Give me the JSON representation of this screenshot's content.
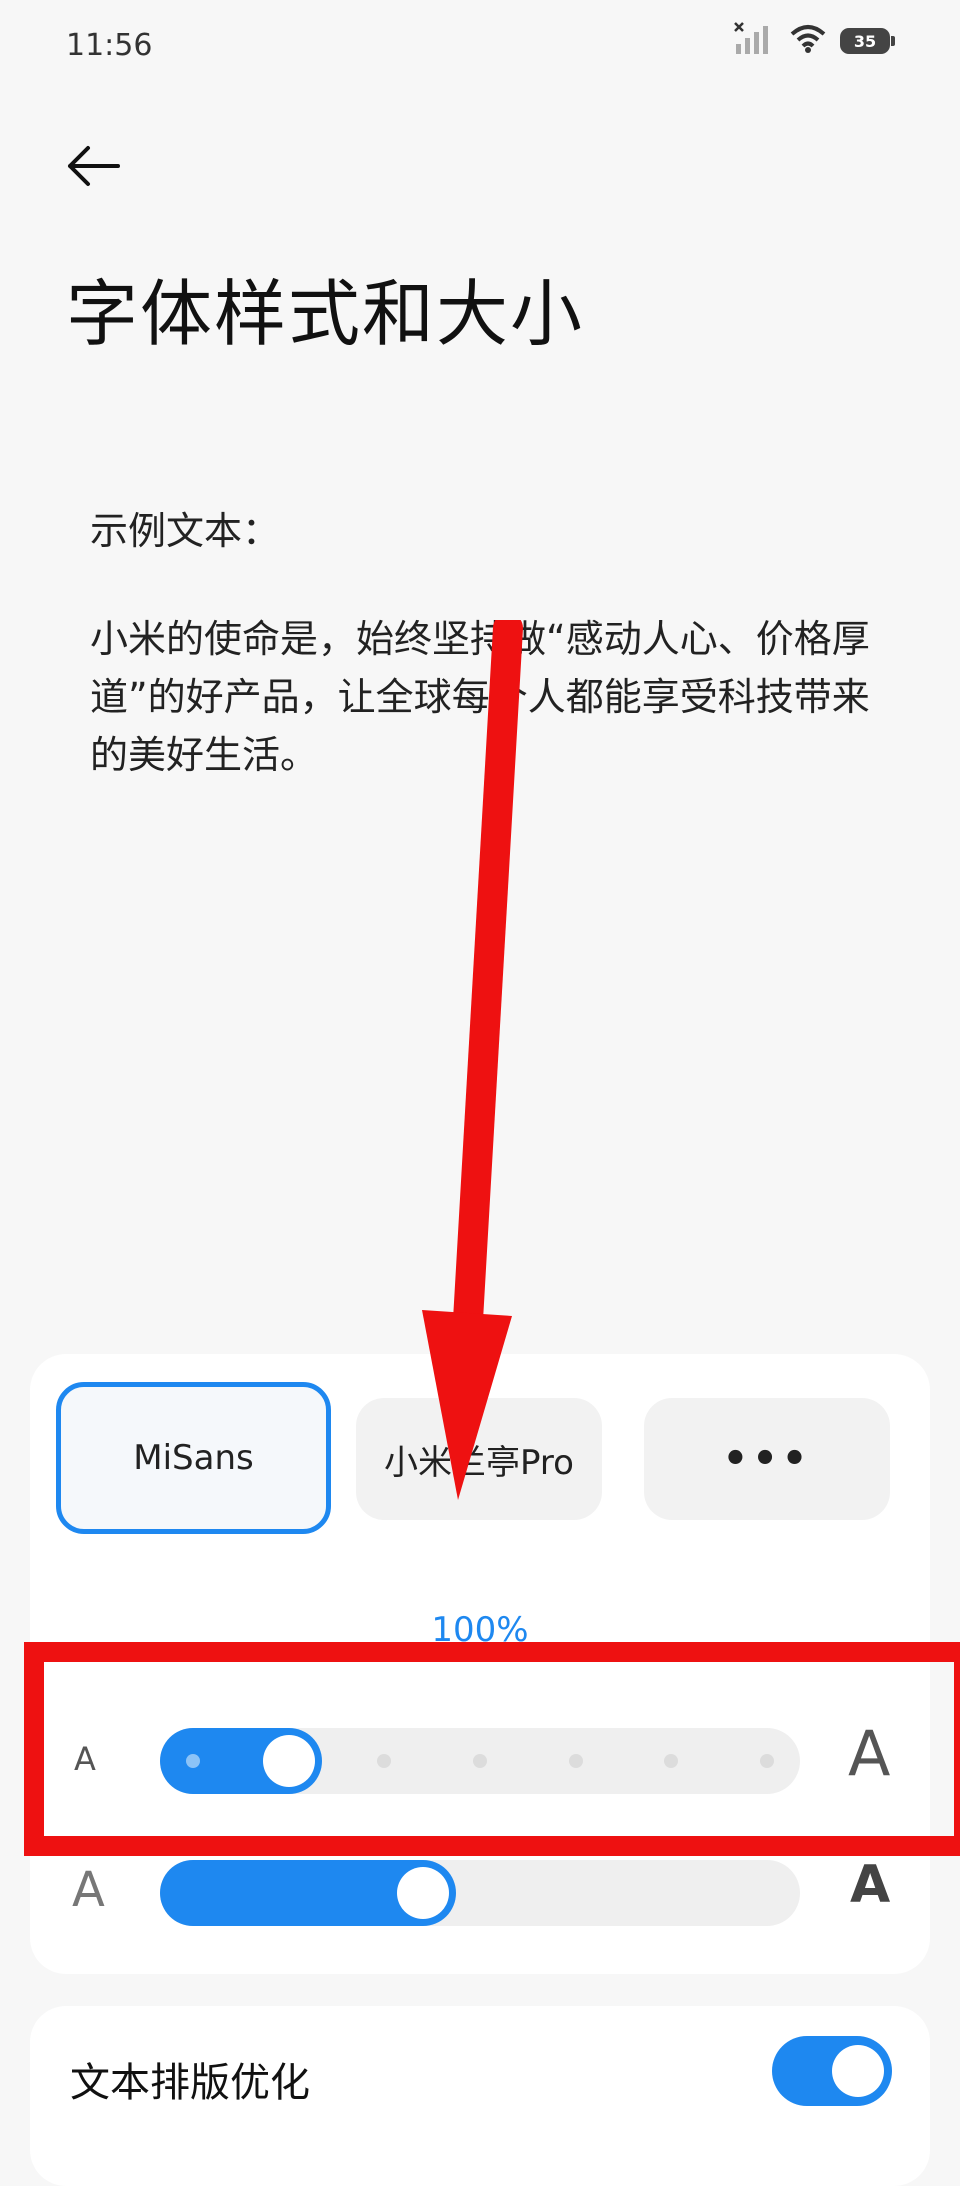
{
  "status_bar": {
    "time": "11:56",
    "battery": "35",
    "icons": [
      "signal-off-icon",
      "wifi-icon",
      "battery-icon"
    ]
  },
  "header": {
    "back_icon": "arrow-left-icon",
    "title": "字体样式和大小"
  },
  "sample": {
    "label": "示例文本：",
    "text": "小米的使命是，始终坚持做“感动人心、价格厚道”的好产品，让全球每个人都能享受科技带来的美好生活。"
  },
  "font_options": [
    {
      "label": "MiSans",
      "selected": true
    },
    {
      "label": "小米兰亭Pro",
      "selected": false
    },
    {
      "label": "•••",
      "selected": false
    }
  ],
  "font_size": {
    "percent_label": "100%",
    "small_label": "A",
    "large_label": "A",
    "level": 1,
    "levels": 7
  },
  "font_weight": {
    "small_label": "A",
    "large_label": "A",
    "fraction": 0.4
  },
  "typography": {
    "label": "文本排版优化",
    "enabled": true
  },
  "colors": {
    "accent": "#1e88f0",
    "annotation": "#ee1111"
  }
}
